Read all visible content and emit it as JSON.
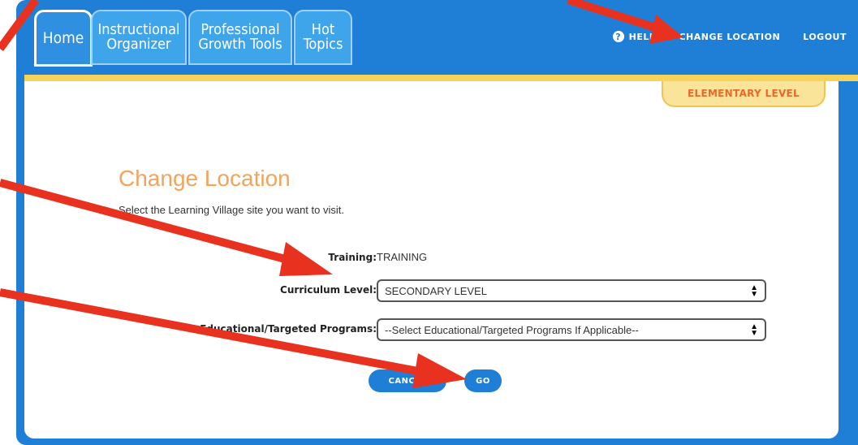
{
  "tabs": [
    {
      "label": "Home"
    },
    {
      "label": "Instructional\nOrganizer"
    },
    {
      "label": "Professional\nGrowth Tools"
    },
    {
      "label": "Hot\nTopics"
    }
  ],
  "top_links": {
    "help": "HELP",
    "change_location": "CHANGE LOCATION",
    "logout": "LOGOUT"
  },
  "level_badge": "ELEMENTARY LEVEL",
  "page": {
    "title": "Change Location",
    "subtitle": "Select the Learning Village site you want to visit."
  },
  "form": {
    "training_label": "Training:",
    "training_value": "TRAINING",
    "curriculum_label": "Curriculum Level:",
    "curriculum_value": "SECONDARY LEVEL",
    "programs_label": "Educational/Targeted Programs:",
    "programs_value": "--Select Educational/Targeted Programs If Applicable--"
  },
  "buttons": {
    "cancel": "CANCEL",
    "go": "GO"
  },
  "colors": {
    "primary_blue": "#1f7fd6",
    "accent_yellow": "#f7d35a",
    "title_orange": "#f2a45c",
    "annotation_red": "#e8321f"
  }
}
